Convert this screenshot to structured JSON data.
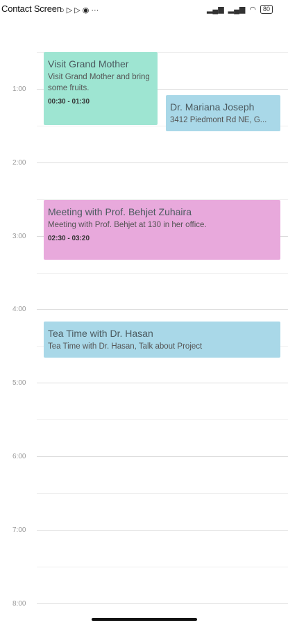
{
  "app": {
    "title": "Contact Screen"
  },
  "status_bar": {
    "left_icons": "○ ▷ ▷ ◉ ···",
    "right_icons": [
      "signal-icon",
      "signal-icon",
      "wifi-icon"
    ],
    "battery": "80"
  },
  "time_labels": [
    "1:00",
    "2:00",
    "3:00",
    "4:00",
    "5:00",
    "6:00",
    "7:00",
    "8:00"
  ],
  "events": [
    {
      "title": "Visit Grand Mother",
      "description": "Visit Grand Mother and bring some fruits.",
      "time": "00:30 - 01:30",
      "color": "#9ee5d2"
    },
    {
      "title": "Dr. Mariana Joseph",
      "description": "3412 Piedmont Rd NE, G...",
      "time": "",
      "color": "#a9d8e8"
    },
    {
      "title": "Meeting with Prof. Behjet Zuhaira",
      "description": "Meeting with Prof. Behjet at 130 in her office.",
      "time": "02:30 - 03:20",
      "color": "#e8a9dc"
    },
    {
      "title": "Tea Time with Dr. Hasan",
      "description": "Tea Time with Dr. Hasan, Talk about Project",
      "time": "",
      "color": "#a9d8e8"
    }
  ]
}
